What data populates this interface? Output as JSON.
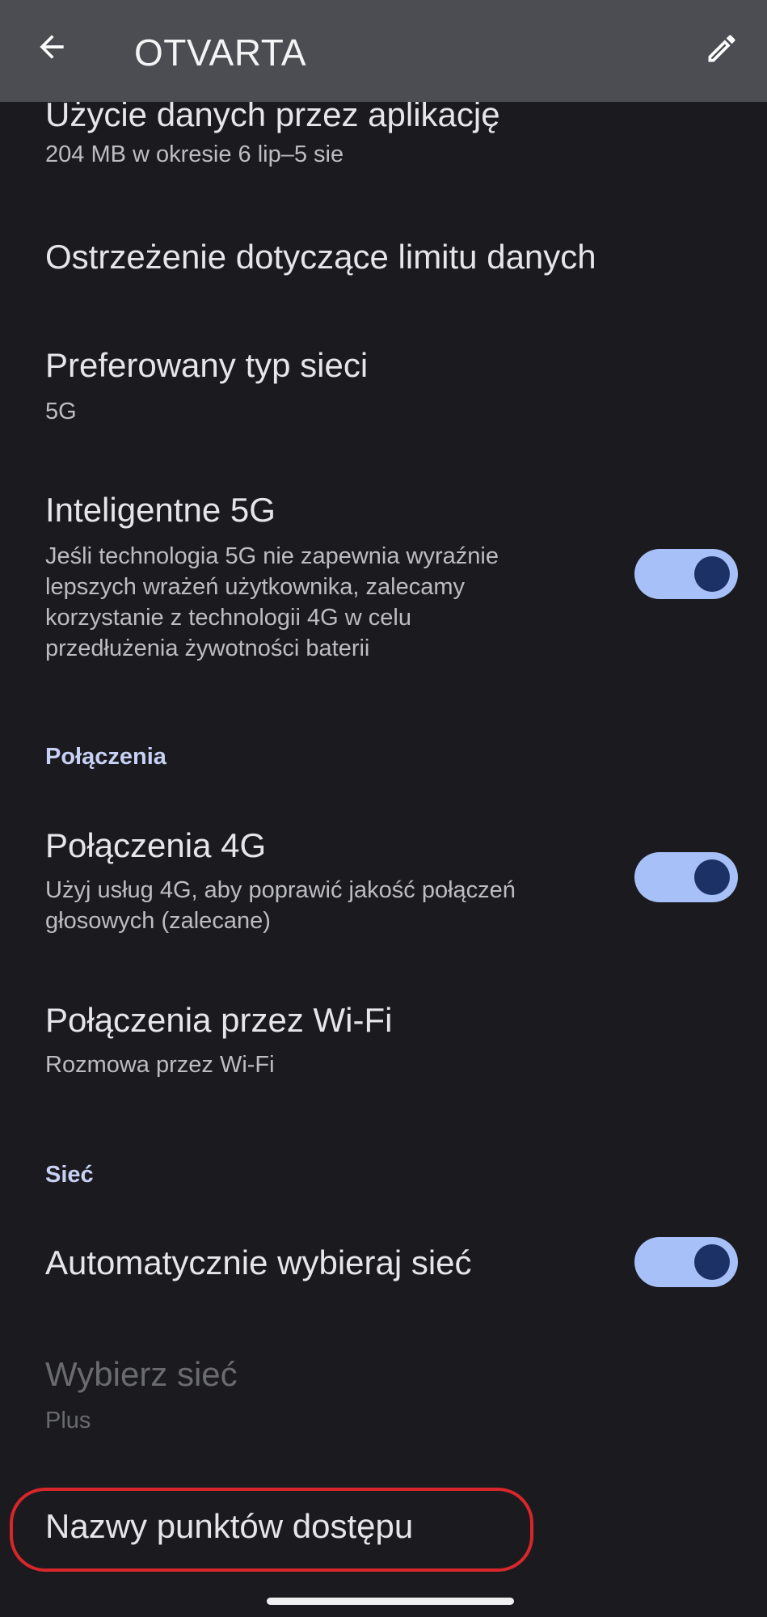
{
  "header": {
    "title": "OTVARTA",
    "back_icon": "arrow-back-icon",
    "edit_icon": "pencil-icon"
  },
  "items": {
    "data_usage": {
      "title": "Użycie danych przez aplikację",
      "subtitle": "204 MB w okresie 6 lip–5 sie"
    },
    "data_warning": {
      "title": "Ostrzeżenie dotyczące limitu danych"
    },
    "network_type": {
      "title": "Preferowany typ sieci",
      "subtitle": "5G"
    },
    "smart_5g": {
      "title": "Inteligentne 5G",
      "subtitle_lines": [
        "Jeśli technologia 5G nie zapewnia wyraźnie",
        "lepszych wrażeń użytkownika, zalecamy",
        "korzystanie z technologii 4G w celu",
        "przedłużenia żywotności baterii"
      ],
      "enabled": true
    },
    "section_calls": "Połączenia",
    "calls_4g": {
      "title": "Połączenia 4G",
      "subtitle_lines": [
        "Użyj usług 4G, aby poprawić jakość połączeń",
        "głosowych (zalecane)"
      ],
      "enabled": true
    },
    "wifi_calls": {
      "title": "Połączenia przez Wi-Fi",
      "subtitle": "Rozmowa przez Wi-Fi"
    },
    "section_network": "Sieć",
    "auto_network": {
      "title": "Automatycznie wybieraj sieć",
      "enabled": true
    },
    "select_network": {
      "title": "Wybierz sieć",
      "subtitle": "Plus"
    },
    "apn": {
      "title": "Nazwy punktów dostępu"
    }
  },
  "colors": {
    "background": "#1b1b1f",
    "topbar": "#4b4d52",
    "switch_track": "#a8c0f8",
    "switch_knob": "#1c3166",
    "section_header": "#c7d1f4",
    "highlight": "#d8262a"
  }
}
